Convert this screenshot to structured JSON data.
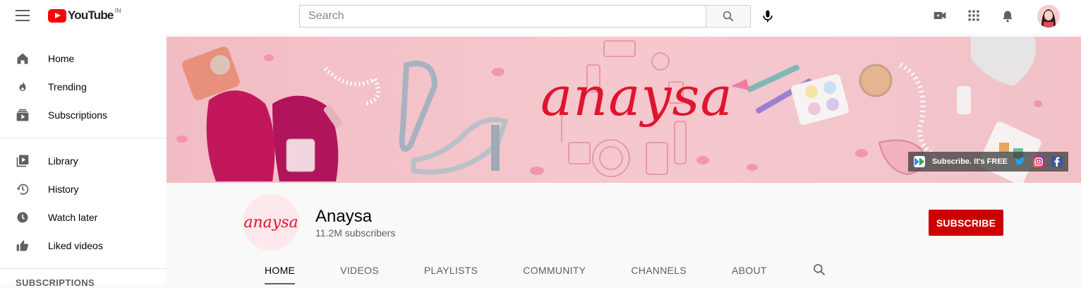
{
  "header": {
    "logo_text": "YouTube",
    "country_code": "IN",
    "search_placeholder": "Search"
  },
  "sidebar": {
    "items": [
      {
        "label": "Home",
        "icon": "home-icon"
      },
      {
        "label": "Trending",
        "icon": "flame-icon"
      },
      {
        "label": "Subscriptions",
        "icon": "subscriptions-icon"
      },
      {
        "label": "Library",
        "icon": "library-icon"
      },
      {
        "label": "History",
        "icon": "history-icon"
      },
      {
        "label": "Watch later",
        "icon": "clock-icon"
      },
      {
        "label": "Liked videos",
        "icon": "thumbs-up-icon"
      }
    ],
    "section_heading": "SUBSCRIPTIONS"
  },
  "banner": {
    "title": "anaysa",
    "subscribe_text": "Subscribe. It's FREE"
  },
  "channel": {
    "name": "Anaysa",
    "subscribers": "11.2M subscribers",
    "avatar_text": "anaysa",
    "subscribe_label": "SUBSCRIBE"
  },
  "tabs": [
    "HOME",
    "VIDEOS",
    "PLAYLISTS",
    "COMMUNITY",
    "CHANNELS",
    "ABOUT"
  ],
  "colors": {
    "brand_red": "#ff0000",
    "subscribe_red": "#cc0000",
    "banner_pink": "#f4c8cd"
  }
}
